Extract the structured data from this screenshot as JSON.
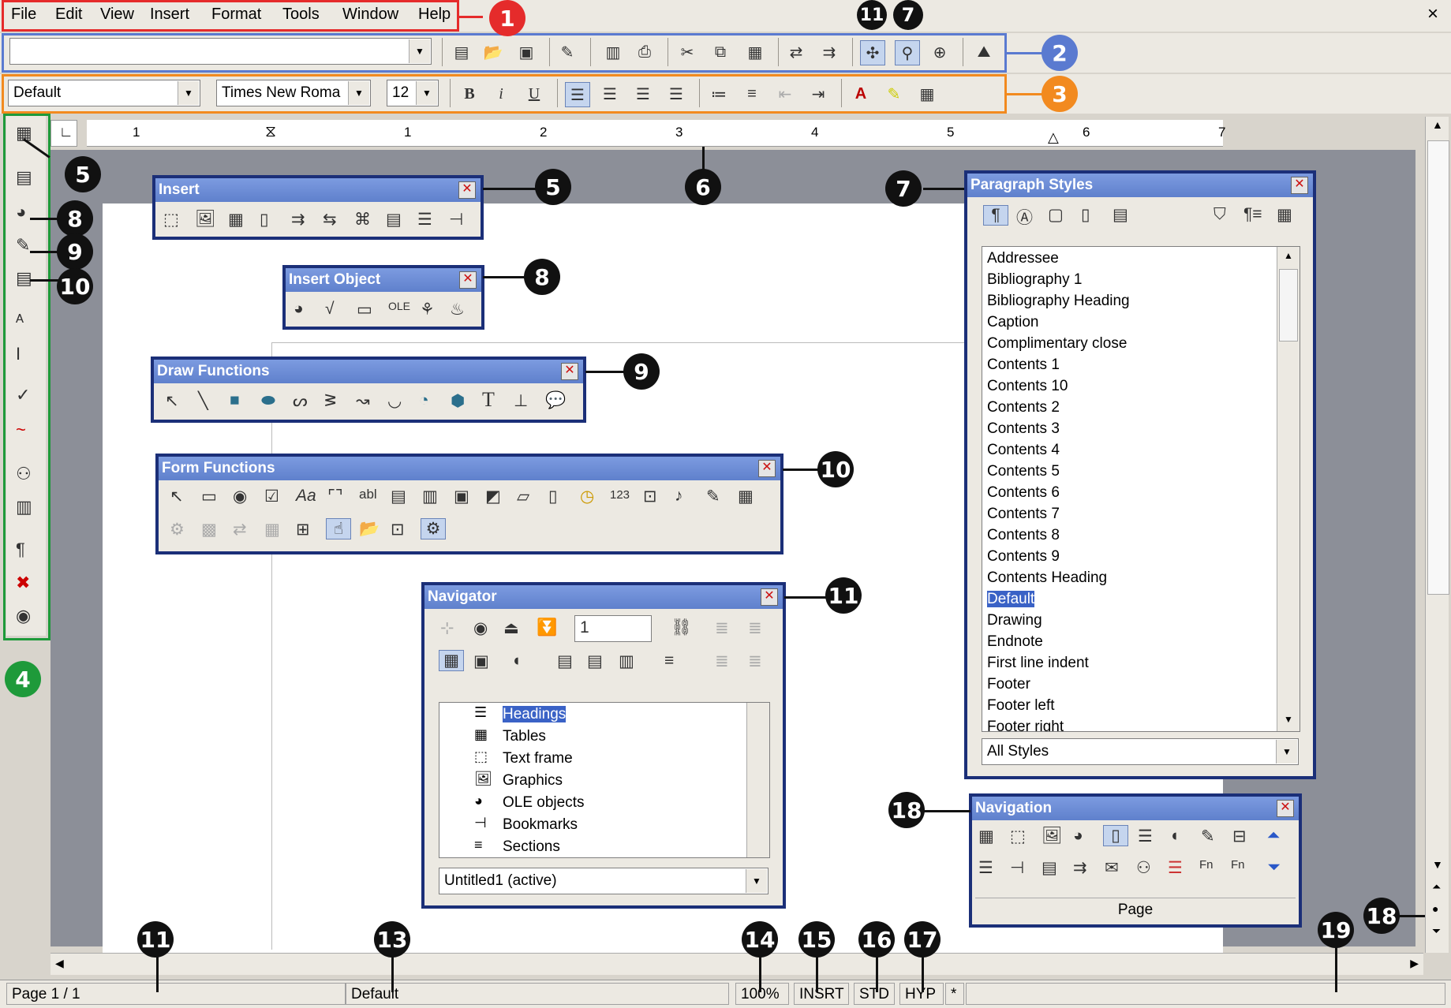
{
  "menu": [
    {
      "label": "File",
      "u": "F"
    },
    {
      "label": "Edit",
      "u": "E"
    },
    {
      "label": "View",
      "u": "V"
    },
    {
      "label": "Insert",
      "u": "I"
    },
    {
      "label": "Format",
      "u": "o"
    },
    {
      "label": "Tools",
      "u": "T"
    },
    {
      "label": "Window",
      "u": "W"
    },
    {
      "label": "Help",
      "u": "H"
    }
  ],
  "window_close": "×",
  "function_bar": {
    "url_value": ""
  },
  "object_bar": {
    "style_value": "Default",
    "font_value": "Times New Roma",
    "size_value": "12",
    "bold": "B",
    "italic": "i",
    "underline": "U"
  },
  "ruler_numbers": [
    "1",
    "1",
    "2",
    "3",
    "4",
    "5",
    "6",
    "7"
  ],
  "palettes": {
    "insert": {
      "title": "Insert"
    },
    "insert_object": {
      "title": "Insert Object"
    },
    "draw_functions": {
      "title": "Draw Functions"
    },
    "form_functions": {
      "title": "Form Functions"
    },
    "navigator": {
      "title": "Navigator",
      "page_value": "1",
      "items": [
        "Headings",
        "Tables",
        "Text frame",
        "Graphics",
        "OLE objects",
        "Bookmarks",
        "Sections"
      ],
      "selected": "Headings",
      "document": "Untitled1 (active)"
    },
    "paragraph_styles": {
      "title": "Paragraph Styles",
      "items": [
        "Addressee",
        "Bibliography 1",
        "Bibliography Heading",
        "Caption",
        "Complimentary close",
        "Contents 1",
        "Contents 10",
        "Contents 2",
        "Contents 3",
        "Contents 4",
        "Contents 5",
        "Contents 6",
        "Contents 7",
        "Contents 8",
        "Contents 9",
        "Contents Heading",
        "Default",
        "Drawing",
        "Endnote",
        "First line indent",
        "Footer",
        "Footer left",
        "Footer right"
      ],
      "selected": "Default",
      "filter": "All Styles"
    },
    "navigation": {
      "title": "Navigation",
      "footer": "Page"
    }
  },
  "status": {
    "page": "Page 1 / 1",
    "style": "Default",
    "zoom": "100%",
    "insert": "INSRT",
    "selection": "STD",
    "hyperlink": "HYP",
    "modified": "*"
  },
  "callouts": {
    "c1": "1",
    "c2": "2",
    "c3": "3",
    "c4": "4",
    "c5a": "5",
    "c5b": "5",
    "c6": "6",
    "c7a": "7",
    "c7b": "7",
    "c8a": "8",
    "c8b": "8",
    "c9a": "9",
    "c9b": "9",
    "c10a": "10",
    "c10b": "10",
    "c11a": "11",
    "c11b": "11",
    "c11c": "11",
    "c13": "13",
    "c14": "14",
    "c15": "15",
    "c16": "16",
    "c17": "17",
    "c18a": "18",
    "c18b": "18",
    "c19": "19"
  },
  "colors": {
    "menu_box": "#e52b2b",
    "function_box": "#5a7ad0",
    "object_box": "#f28a1f",
    "left_box": "#1e9a3a",
    "title_bar": "#5f80cc"
  }
}
